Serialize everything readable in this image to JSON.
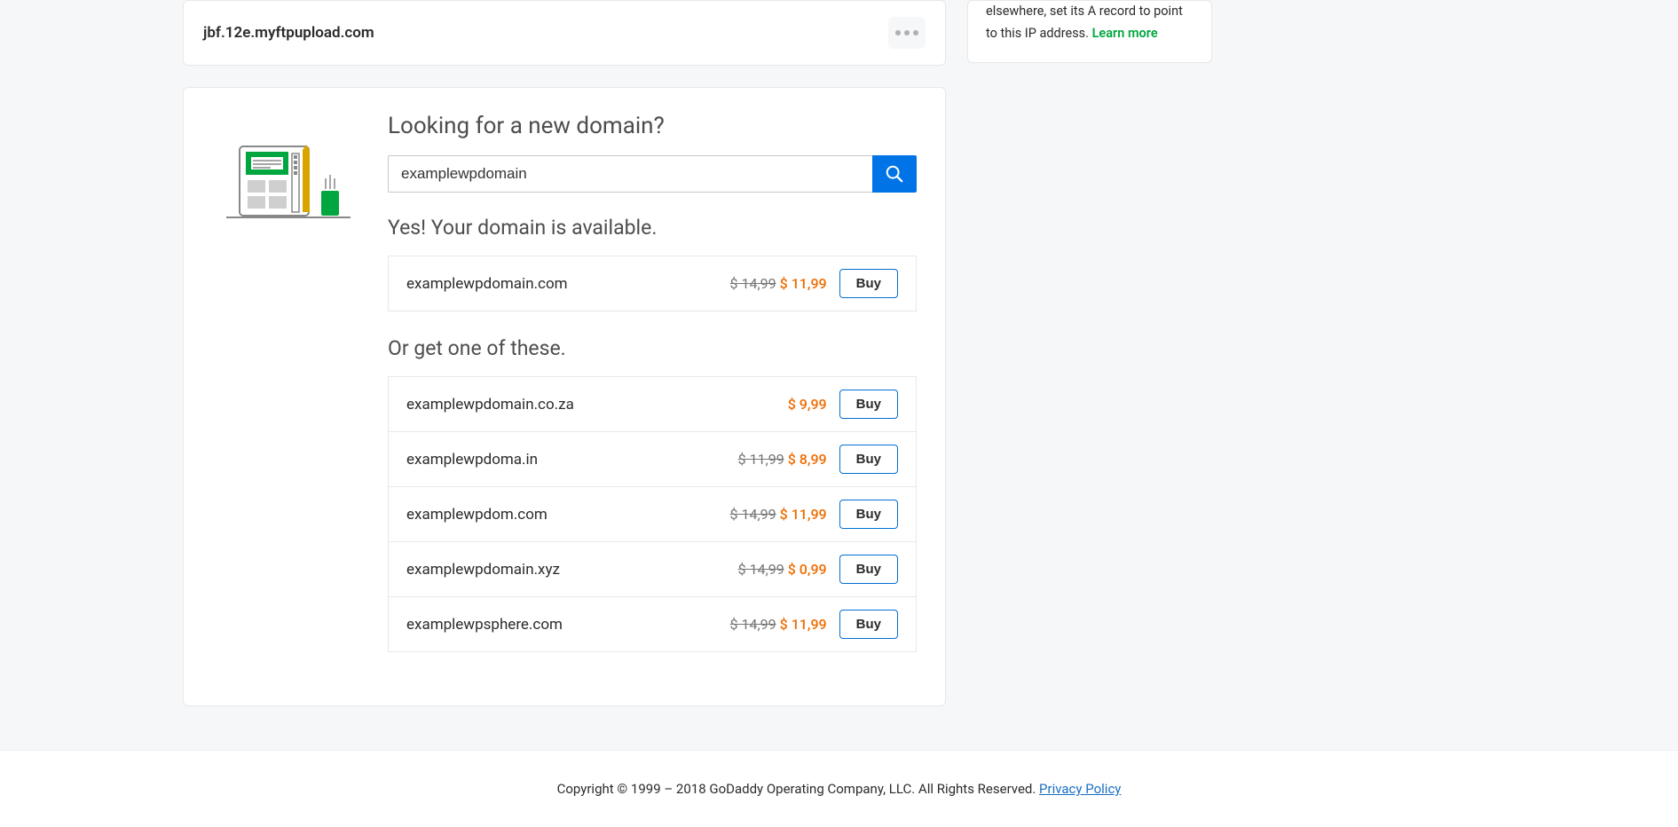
{
  "domain_card": {
    "domain": "jbf.12e.myftpupload.com"
  },
  "search_card": {
    "heading": "Looking for a new domain?",
    "input_value": "examplewpdomain",
    "available_heading": "Yes! Your domain is available.",
    "primary_result": {
      "name": "examplewpdomain.com",
      "old_price": "$ 14,99",
      "new_price": "$ 11,99",
      "buy_label": "Buy"
    },
    "alternatives_heading": "Or get one of these.",
    "alternatives": [
      {
        "name": "examplewpdomain.co.za",
        "old_price": "",
        "new_price": "$ 9,99",
        "buy_label": "Buy"
      },
      {
        "name": "examplewpdoma.in",
        "old_price": "$ 11,99",
        "new_price": "$ 8,99",
        "buy_label": "Buy"
      },
      {
        "name": "examplewpdom.com",
        "old_price": "$ 14,99",
        "new_price": "$ 11,99",
        "buy_label": "Buy"
      },
      {
        "name": "examplewpdomain.xyz",
        "old_price": "$ 14,99",
        "new_price": "$ 0,99",
        "buy_label": "Buy"
      },
      {
        "name": "examplewpsphere.com",
        "old_price": "$ 14,99",
        "new_price": "$ 11,99",
        "buy_label": "Buy"
      }
    ]
  },
  "info_card": {
    "text": "elsewhere, set its A record to point to this IP address. ",
    "link": "Learn more"
  },
  "footer": {
    "text": "Copyright © 1999 – 2018 GoDaddy Operating Company, LLC. All Rights Reserved. ",
    "link": "Privacy Policy"
  }
}
